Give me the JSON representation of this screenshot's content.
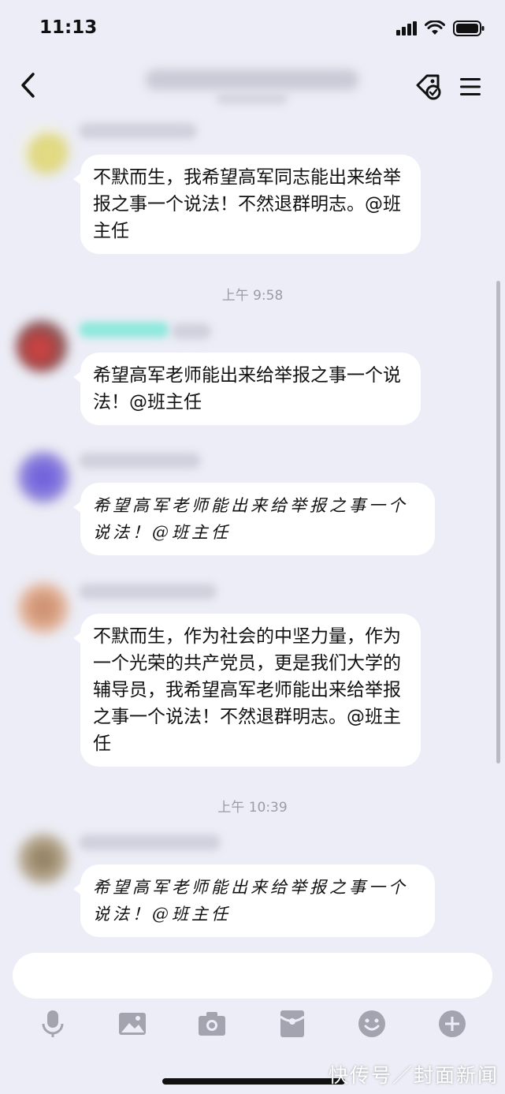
{
  "status_bar": {
    "time": "11:13"
  },
  "chat": {
    "messages": [
      {
        "text": "不默而生，我希望高军同志能出来给举报之事一个说法！不然退群明志。@班主任"
      },
      {
        "text": "希望高军老师能出来给举报之事一个说法！@班主任"
      },
      {
        "text": "希望高军老师能出来给举报之事一个说法！@班主任"
      },
      {
        "text": "不默而生，作为社会的中坚力量，作为一个光荣的共产党员，更是我们大学的辅导员，我希望高军老师能出来给举报之事一个说法！不然退群明志。@班主任"
      },
      {
        "text": "希望高军老师能出来给举报之事一个说法！@班主任"
      }
    ],
    "timestamps": [
      "上午 9:58",
      "上午 10:39"
    ]
  },
  "watermark": "快传号／封面新闻",
  "icons": [
    "back-icon",
    "tag-icon",
    "menu-icon",
    "microphone-icon",
    "image-icon",
    "camera-icon",
    "red-packet-icon",
    "emoji-icon",
    "plus-icon"
  ]
}
